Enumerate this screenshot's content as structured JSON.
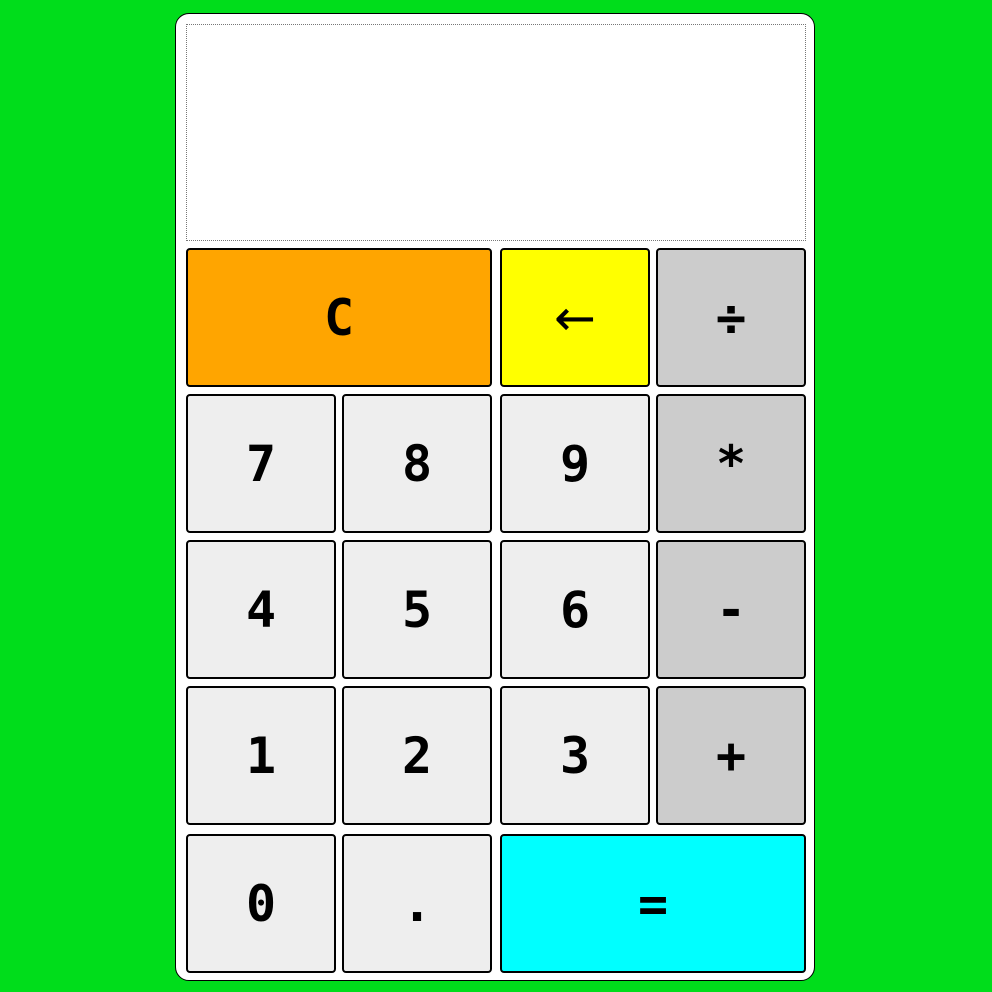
{
  "display": {
    "value": ""
  },
  "keys": {
    "clear": "C",
    "backspace": "←",
    "divide": "÷",
    "seven": "7",
    "eight": "8",
    "nine": "9",
    "multiply": "*",
    "four": "4",
    "five": "5",
    "six": "6",
    "subtract": "-",
    "one": "1",
    "two": "2",
    "three": "3",
    "add": "+",
    "zero": "0",
    "decimal": ".",
    "equals": "="
  },
  "colors": {
    "background": "#00dd1b",
    "clear_key": "#ffa500",
    "backspace_key": "#ffff00",
    "operator_key": "#cccccc",
    "digit_key": "#eeeeee",
    "equals_key": "#00ffff"
  }
}
